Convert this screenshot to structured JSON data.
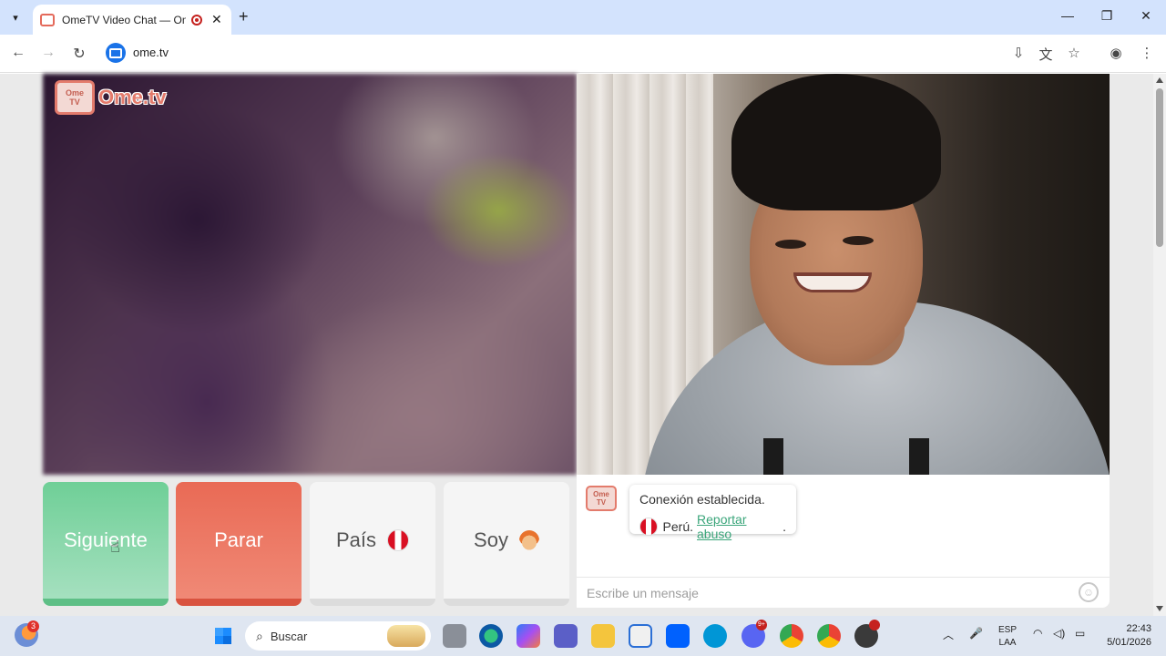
{
  "browser": {
    "tab_title": "OmeTV Video Chat — Ome",
    "url": "ome.tv",
    "new_tab": "+",
    "tab_close": "✕",
    "nav_back": "←",
    "nav_forward": "→",
    "nav_reload": "↻",
    "icons": [
      "install-app-icon",
      "translate-icon",
      "bookmark-star-icon",
      "profile-icon",
      "menu-kebab-icon"
    ]
  },
  "page": {
    "logo_box": [
      "Ome",
      "TV"
    ],
    "logo_text": "Ome.tv",
    "controls": {
      "next": "Siguiente",
      "stop": "Parar",
      "country": "País",
      "soy": "Soy"
    },
    "chat": {
      "avatar_box": [
        "Ome",
        "TV"
      ],
      "status": "Conexión establecida.",
      "country": "Perú.",
      "report": "Reportar abuso",
      "period": ".",
      "placeholder": "Escribe un mensaje"
    }
  },
  "taskbar": {
    "weather_badge": "3",
    "search_placeholder": "Buscar",
    "discord_badge": "9+",
    "lang_top": "ESP",
    "lang_bottom": "LAA",
    "time": "22:43",
    "date": "5/01/2026"
  },
  "colors": {
    "next_button": "#6fcf97",
    "stop_button": "#e96a55",
    "brand": "#e37b6c",
    "link": "#3aa57a"
  }
}
